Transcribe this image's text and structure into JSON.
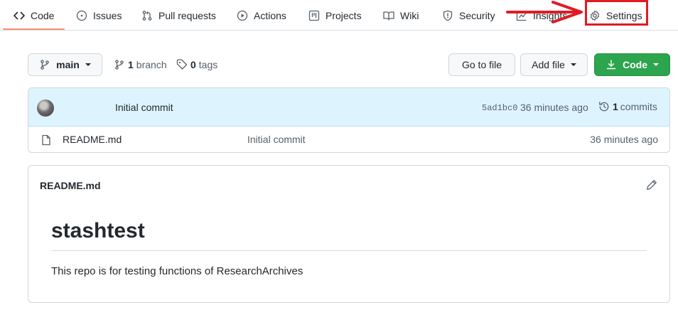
{
  "nav": {
    "code": "Code",
    "issues": "Issues",
    "pulls": "Pull requests",
    "actions": "Actions",
    "projects": "Projects",
    "wiki": "Wiki",
    "security": "Security",
    "insights": "Insights",
    "settings": "Settings"
  },
  "branch": {
    "current": "main",
    "branch_count": "1",
    "branch_word": "branch",
    "tag_count": "0",
    "tag_word": "tags"
  },
  "buttons": {
    "go_to_file": "Go to file",
    "add_file": "Add file",
    "code": "Code"
  },
  "latest_commit": {
    "message": "Initial commit",
    "sha": "5ad1bc0",
    "age": "36 minutes ago",
    "commit_count": "1",
    "commit_word": "commits"
  },
  "files": [
    {
      "name": "README.md",
      "commit": "Initial commit",
      "age": "36 minutes ago"
    }
  ],
  "readme": {
    "filename": "README.md",
    "heading": "stashtest",
    "body": "This repo is for testing functions of ResearchArchives"
  },
  "annotation": {
    "color": "#e01b24",
    "target": "settings"
  },
  "icons": [
    "code-icon",
    "issue-icon",
    "pull-request-icon",
    "play-icon",
    "table-icon",
    "book-icon",
    "shield-icon",
    "graph-icon",
    "gear-icon",
    "branch-icon",
    "tag-icon",
    "download-icon",
    "history-icon",
    "file-icon",
    "pencil-icon"
  ],
  "colors": {
    "primary_green": "#2da44e",
    "commit_bar": "#ddf4ff",
    "underline": "#fd8c73"
  }
}
